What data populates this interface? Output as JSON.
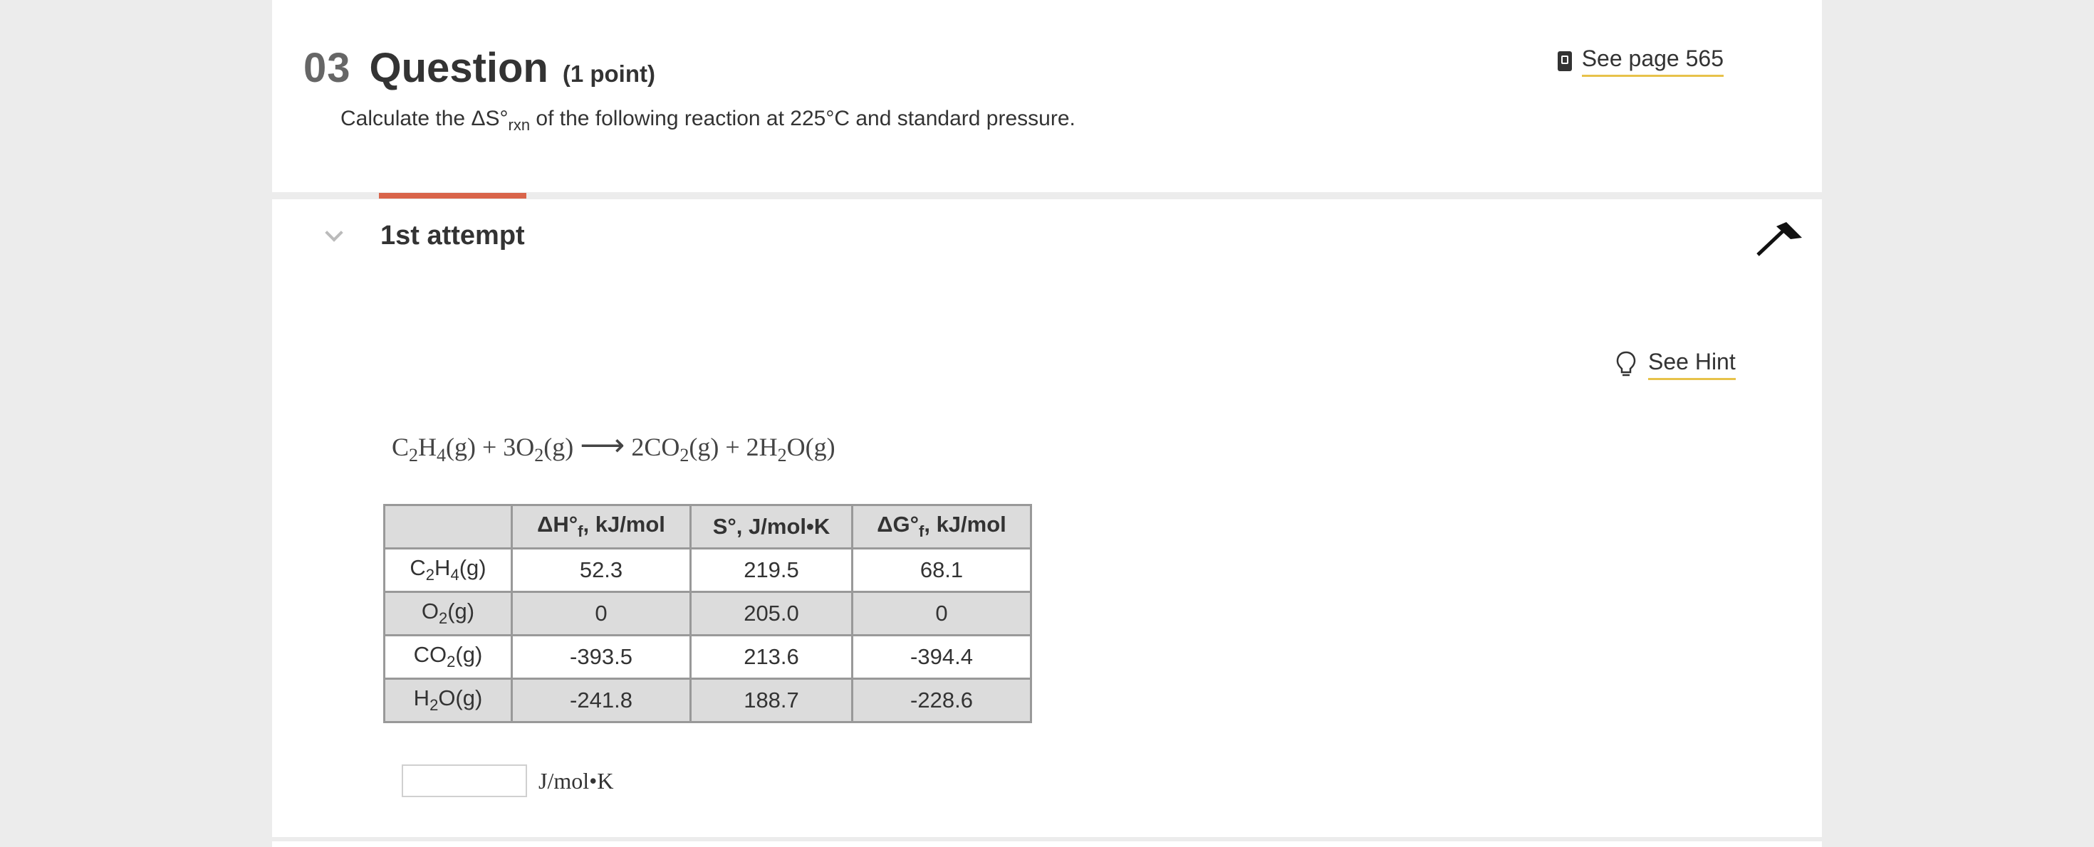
{
  "question": {
    "number": "03",
    "title": "Question",
    "points": "(1 point)",
    "prompt_pre": "Calculate the ΔS°",
    "prompt_sub": "rxn",
    "prompt_post": " of the following reaction at 225°C and standard pressure."
  },
  "reference": {
    "icon": "book-icon",
    "label": "See page 565"
  },
  "attempt": {
    "label": "1st attempt",
    "collapse_icon": "chevron-down-icon",
    "flag_icon": "flag-icon"
  },
  "hint": {
    "icon": "lightbulb-icon",
    "label": "See Hint"
  },
  "equation": {
    "r1_a": "C",
    "r1_s1": "2",
    "r1_b": "H",
    "r1_s2": "4",
    "r1_c": "(g) + 3O",
    "r2_s": "2",
    "r2_c": "(g)",
    "arrow": "⟶",
    "p1_a": "2CO",
    "p1_s": "2",
    "p1_c": "(g) + 2H",
    "p2_s": "2",
    "p2_c": "O(g)"
  },
  "table": {
    "headers": {
      "h1_a": "ΔH°",
      "h1_s": "f",
      "h1_b": ", kJ/mol",
      "h2": "S°, J/mol•K",
      "h3_a": "ΔG°",
      "h3_s": "f",
      "h3_b": ", kJ/mol"
    },
    "rows": [
      {
        "sp_a": "C",
        "sp_s1": "2",
        "sp_b": "H",
        "sp_s2": "4",
        "sp_c": "(g)",
        "dh": "52.3",
        "s": "219.5",
        "dg": "68.1"
      },
      {
        "sp_a": "O",
        "sp_s1": "2",
        "sp_c": "(g)",
        "dh": "0",
        "s": "205.0",
        "dg": "0"
      },
      {
        "sp_a": "CO",
        "sp_s1": "2",
        "sp_c": "(g)",
        "dh": "-393.5",
        "s": "213.6",
        "dg": "-394.4"
      },
      {
        "sp_a": "H",
        "sp_s1": "2",
        "sp_c": "O(g)",
        "dh": "-241.8",
        "s": "188.7",
        "dg": "-228.6"
      }
    ]
  },
  "answer": {
    "value": "",
    "unit": "J/mol•K"
  },
  "colors": {
    "accent_tab": "#d9644a",
    "link_underline": "#e7c24a",
    "table_shade": "#dcdcdc"
  }
}
